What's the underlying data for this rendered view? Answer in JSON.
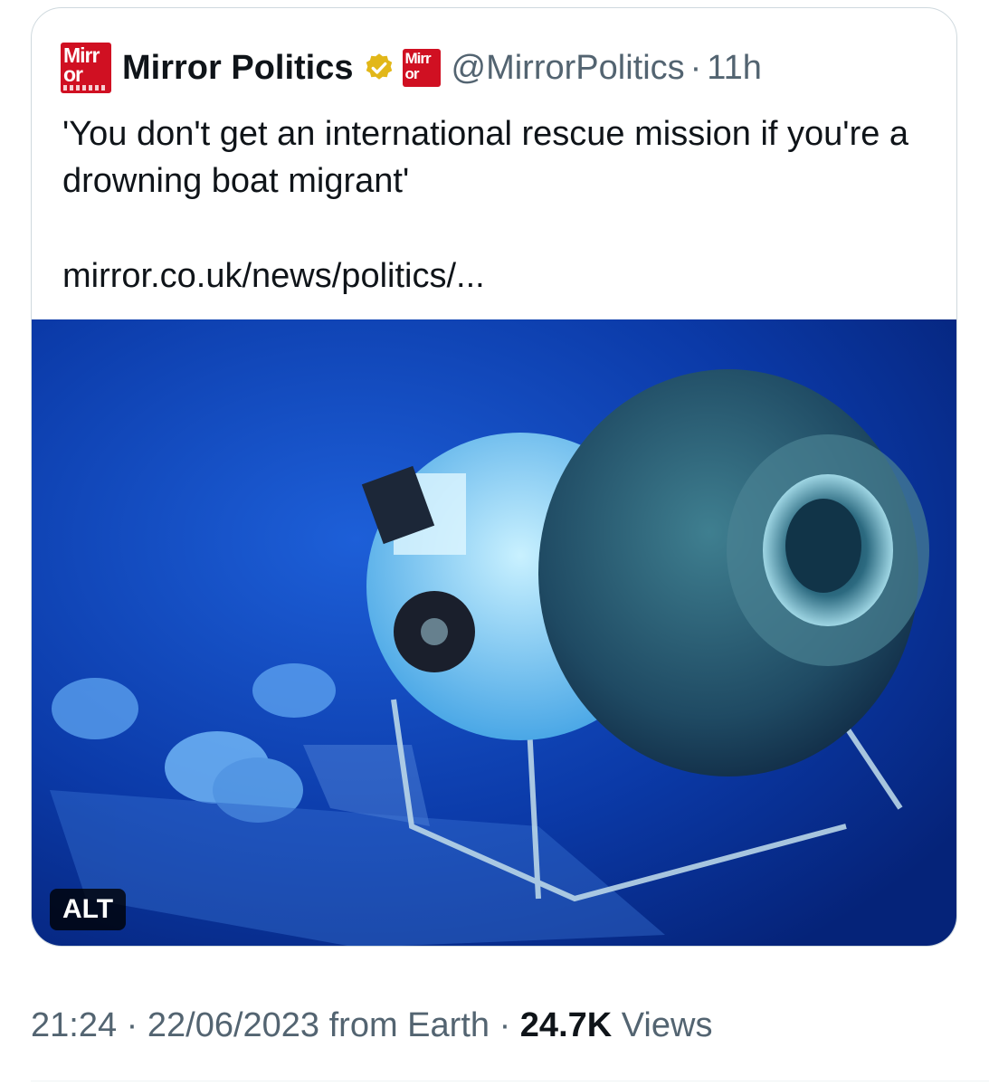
{
  "tweet": {
    "author_name": "Mirror Politics",
    "handle": "@MirrorPolitics",
    "separator": "·",
    "time": "11h",
    "text": "'You don't get an international rescue mission if you're a drowning boat migrant'",
    "link": "mirror.co.uk/news/politics/...",
    "logo_text_top": "Mirr",
    "logo_text_bottom": "or",
    "media_alt_badge": "ALT",
    "verified_icon": "verified-badge-gold"
  },
  "footer": {
    "time": "21:24",
    "sep1": "·",
    "date": "22/06/2023",
    "source": "from Earth",
    "sep2": "·",
    "views_count": "24.7K",
    "views_label": "Views"
  },
  "colors": {
    "brand_red": "#d01022",
    "verified_gold": "#e2b719",
    "secondary_text": "#536471",
    "ocean_blue": "#0a3fb0"
  }
}
